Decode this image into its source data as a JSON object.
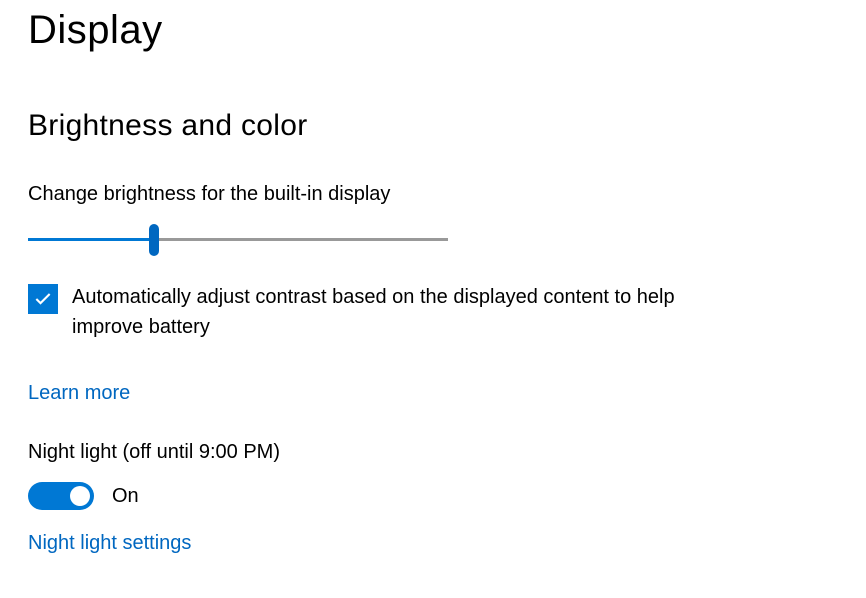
{
  "page": {
    "title": "Display"
  },
  "section": {
    "title": "Brightness and color"
  },
  "brightness": {
    "label": "Change brightness for the built-in display",
    "value": 30
  },
  "auto_contrast": {
    "checked": true,
    "label": "Automatically adjust contrast based on the displayed content to help improve battery"
  },
  "learn_more": {
    "label": "Learn more"
  },
  "night_light": {
    "label": "Night light (off until 9:00 PM)",
    "state": "On",
    "enabled": true,
    "settings_link": "Night light settings"
  }
}
